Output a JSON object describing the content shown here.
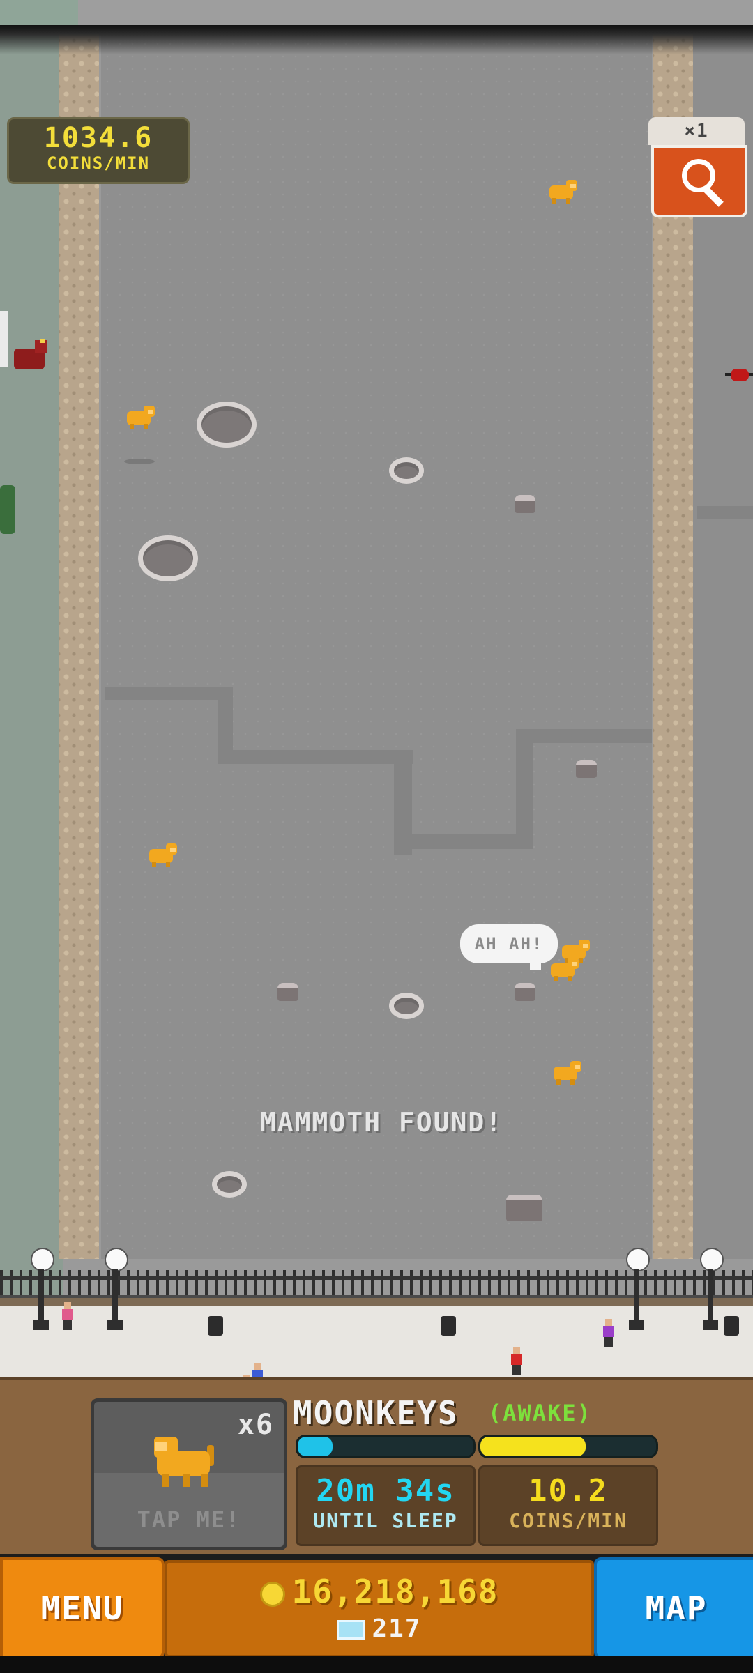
{
  "hud": {
    "coins_per_min_value": "1034.6",
    "coins_per_min_unit": "COINS/MIN",
    "search_multiplier": "×1",
    "search_icon": "magnifier-icon"
  },
  "world": {
    "speech_bubble": "AH AH!",
    "event_text": "MAMMOTH FOUND!"
  },
  "animal_panel": {
    "count": "x6",
    "tap_label": "TAP ME!",
    "species_name": "MOONKEYS",
    "species_state": "(AWAKE)",
    "sleep_progress": 0.2,
    "coin_progress": 0.6,
    "sleep_timer": "20m 34s",
    "sleep_label": "UNTIL SLEEP",
    "coins_rate": "10.2",
    "coins_rate_label": "COINS/MIN"
  },
  "footer": {
    "menu_label": "MENU",
    "map_label": "MAP",
    "coins": "16,218,168",
    "gems": "217"
  },
  "colors": {
    "menu": "#ef8a0f",
    "map": "#1696e6",
    "coins_text": "#f7d735",
    "sleep_bar": "#1fc2e8",
    "coin_bar": "#f5e21d",
    "awake": "#7de03c"
  }
}
